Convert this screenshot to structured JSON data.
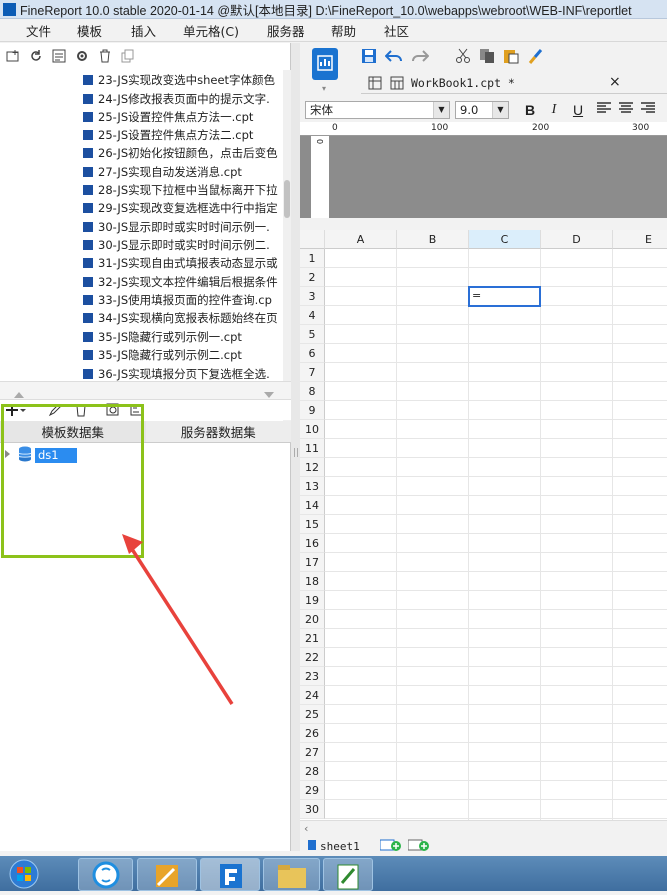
{
  "window": {
    "title": "FineReport 10.0 stable 2020-01-14 @默认[本地目录]   D:\\FineReport_10.0\\webapps\\webroot\\WEB-INF\\reportlet"
  },
  "menubar": {
    "items": [
      "文件",
      "模板",
      "插入",
      "单元格(C)",
      "服务器",
      "帮助",
      "社区"
    ]
  },
  "file_list": {
    "items": [
      "23-JS实现改变选中sheet字体颜色",
      "24-JS修改报表页面中的提示文字.",
      "25-JS设置控件焦点方法一.cpt",
      "25-JS设置控件焦点方法二.cpt",
      "26-JS初始化按钮颜色，点击后变色",
      "27-JS实现自动发送消息.cpt",
      "28-JS实现下拉框中当鼠标离开下拉",
      "29-JS实现改变复选框选中行中指定",
      "30-JS显示即时或实时时间示例一.",
      "30-JS显示即时或实时时间示例二.",
      "31-JS实现自由式填报表动态显示或",
      "32-JS实现文本控件编辑后根据条件",
      "33-JS使用填报页面的控件查询.cp",
      "34-JS实现横向宽报表标题始终在页",
      "35-JS隐藏行或列示例一.cpt",
      "35-JS隐藏行或列示例二.cpt",
      "36-JS实现填报分页下复选框全选."
    ]
  },
  "dataset_panel": {
    "tabs": [
      "模板数据集",
      "服务器数据集"
    ],
    "items": [
      "ds1"
    ]
  },
  "editor": {
    "tab_label": "WorkBook1.cpt *",
    "font_name": "宋体",
    "font_size": "9.0",
    "ruler_ticks": [
      "0",
      "100",
      "200",
      "300"
    ],
    "columns": [
      "A",
      "B",
      "C",
      "D",
      "E"
    ],
    "rows": [
      "1",
      "2",
      "3",
      "4",
      "5",
      "6",
      "7",
      "8",
      "9",
      "10",
      "11",
      "12",
      "13",
      "14",
      "15",
      "16",
      "17",
      "18",
      "19",
      "20",
      "21",
      "22",
      "23",
      "24",
      "25",
      "26",
      "27",
      "28",
      "29",
      "30"
    ],
    "selected_cell_value": "=",
    "sheet_tab": "sheet1"
  },
  "colors": {
    "highlight_box": "#8cc21a",
    "annotation_arrow": "#e8423c",
    "selection": "#2a6fd6"
  }
}
